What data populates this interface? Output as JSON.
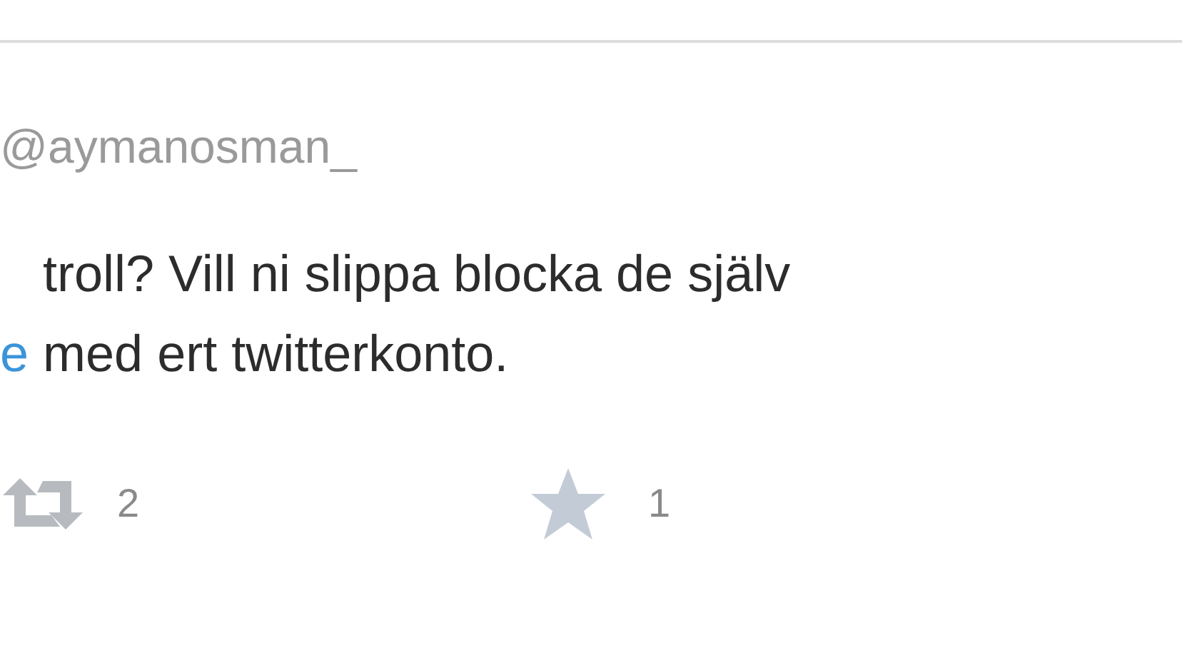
{
  "tweet": {
    "handle": "@aymanosman_",
    "lines": [
      {
        "parts": [
          {
            "kind": "text",
            "text": "troll? Vill ni slippa blocka de själv"
          }
        ]
      },
      {
        "parts": [
          {
            "kind": "link",
            "text": "e"
          },
          {
            "kind": "text",
            "text": " med ert twitterkonto."
          }
        ]
      }
    ],
    "actions": [
      {
        "kind": "retweet",
        "count": "2"
      },
      {
        "kind": "favorite",
        "count": "1"
      }
    ]
  }
}
